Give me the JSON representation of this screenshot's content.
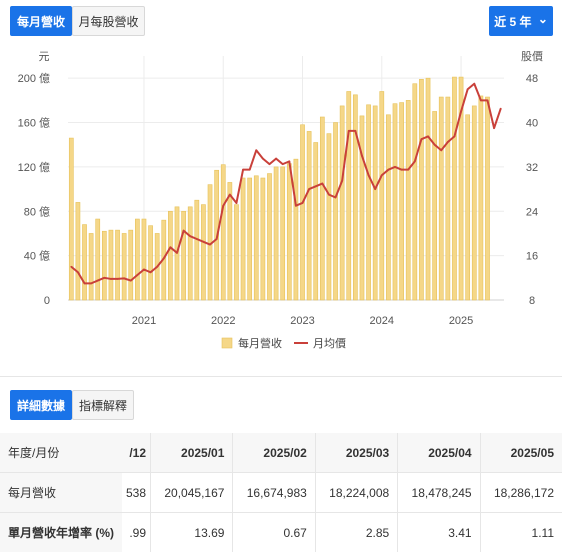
{
  "tabs": {
    "monthly": "每月營收",
    "eps": "月每股營收"
  },
  "range": {
    "label": "近 5 年",
    "chevron": "⌄"
  },
  "buttons": {
    "detail": "詳細數據",
    "explain": "指標解釋"
  },
  "colors": {
    "primary": "#1a73e8",
    "bar": "#f5d788",
    "bar_border": "#e6c25a",
    "line": "#c9403a"
  },
  "chart_data": {
    "type": "bar+line",
    "y_left_unit": "元",
    "y_right_unit": "股價",
    "y_left_ticks": [
      "0",
      "40 億",
      "80 億",
      "120 億",
      "160 億",
      "200 億"
    ],
    "y_right_ticks": [
      "8",
      "16",
      "24",
      "32",
      "40",
      "48"
    ],
    "ylim_left": [
      0,
      220
    ],
    "ylim_right": [
      8,
      52
    ],
    "x_ticks": [
      "2021",
      "2022",
      "2023",
      "2024",
      "2025"
    ],
    "legend": [
      "每月營收",
      "月均價"
    ],
    "legend_position": "bottom",
    "series": [
      {
        "name": "每月營收",
        "type": "bar",
        "unit": "億",
        "start": "2020-02",
        "values": [
          146,
          88,
          68,
          60,
          73,
          62,
          63,
          63,
          60,
          63,
          73,
          73,
          67,
          60,
          72,
          80,
          84,
          80,
          84,
          90,
          86,
          104,
          117,
          122,
          106,
          86,
          110,
          110,
          112,
          110,
          114,
          120,
          120,
          123,
          127,
          158,
          152,
          142,
          165,
          150,
          160,
          175,
          188,
          185,
          166,
          176,
          175,
          188,
          167,
          177,
          178,
          180,
          195,
          199,
          200,
          170,
          183,
          183,
          201,
          201,
          167,
          175,
          184,
          183
        ]
      },
      {
        "name": "月均價",
        "type": "line",
        "start": "2020-02",
        "values": [
          14,
          13,
          11,
          11,
          11.5,
          12,
          11.8,
          11.8,
          11.9,
          11.5,
          12.5,
          13.5,
          13,
          14,
          15.5,
          17.5,
          16.5,
          20.5,
          19.5,
          19,
          18.5,
          18,
          19,
          25,
          27,
          25.5,
          31.5,
          31.5,
          35,
          33.5,
          32.5,
          33.5,
          32.5,
          33,
          25,
          25.5,
          28,
          28.5,
          29,
          27,
          26.5,
          29.5,
          38.5,
          38.5,
          34,
          30.5,
          28,
          30.5,
          31.5,
          32,
          31.5,
          31.5,
          33,
          37,
          37.5,
          36,
          35,
          36.5,
          37.5,
          42,
          46,
          47,
          44,
          44,
          39,
          42.5
        ]
      }
    ]
  },
  "table": {
    "header": [
      "年度/月份",
      "/12",
      "2025/01",
      "2025/02",
      "2025/03",
      "2025/04",
      "2025/05"
    ],
    "rows": [
      {
        "label": "每月營收",
        "cut": "538",
        "values": [
          "20,045,167",
          "16,674,983",
          "18,224,008",
          "18,478,245",
          "18,286,172"
        ]
      },
      {
        "label": "單月營收年增率 (%)",
        "cut": ".99",
        "values": [
          "13.69",
          "0.67",
          "2.85",
          "3.41",
          "1.11"
        ]
      }
    ]
  }
}
